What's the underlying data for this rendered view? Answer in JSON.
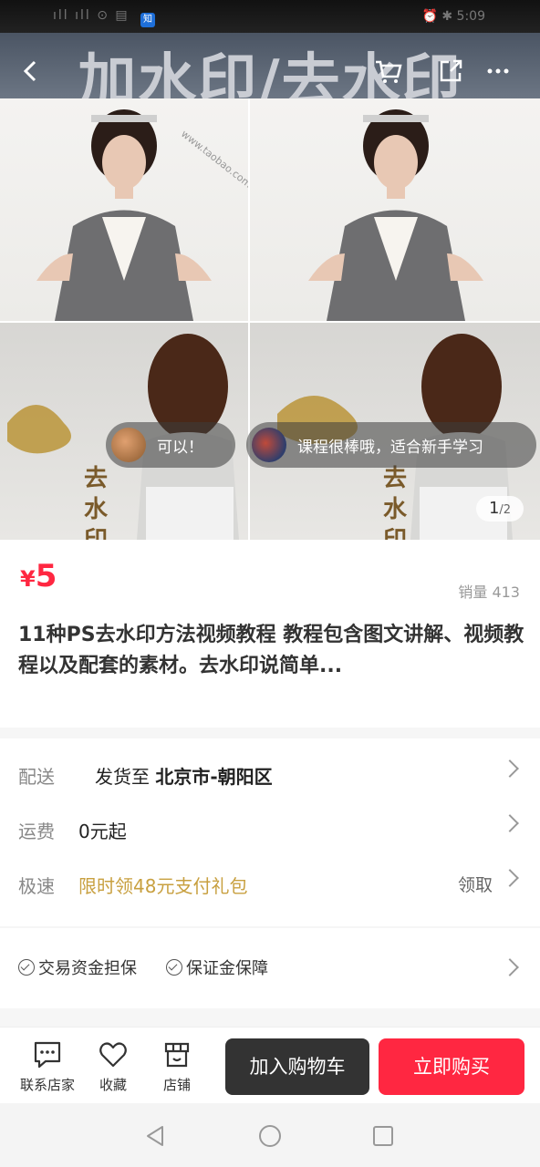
{
  "status_bar": {
    "left": "ıll ıll ⊙ ▤",
    "badge": "知",
    "right": "⏰ ✱ 5:09"
  },
  "banner": {
    "text": "加水印/去水印"
  },
  "hero": {
    "watermark": "www.taobao.com",
    "vertical_text": [
      "去",
      "水",
      "印"
    ],
    "comments": [
      {
        "text": "可以！"
      },
      {
        "text": "课程很棒哦，适合新手学习"
      }
    ],
    "page": {
      "current": "1",
      "total": "/2"
    }
  },
  "product": {
    "price_symbol": "¥",
    "price": "5",
    "sales_label": "销量 413",
    "title": "11种PS去水印方法视频教程 教程包含图文讲解、视频教程以及配套的素材。去水印说简单..."
  },
  "details": {
    "delivery": {
      "label": "配送",
      "value_prefix": "发货至 ",
      "value_bold": "北京市-朝阳区"
    },
    "shipping": {
      "label": "运费",
      "value": "0元起"
    },
    "express": {
      "label": "极速",
      "value": "限时领48元支付礼包",
      "action": "领取"
    }
  },
  "guarantees": {
    "items": [
      "交易资金担保",
      "保证金保障"
    ]
  },
  "bottom_bar": {
    "contact": "联系店家",
    "favorite": "收藏",
    "shop": "店铺",
    "add_to_cart": "加入购物车",
    "buy_now": "立即购买"
  },
  "colors": {
    "accent": "#ff2741",
    "gold": "#c8a040",
    "dark_button": "#333333"
  }
}
